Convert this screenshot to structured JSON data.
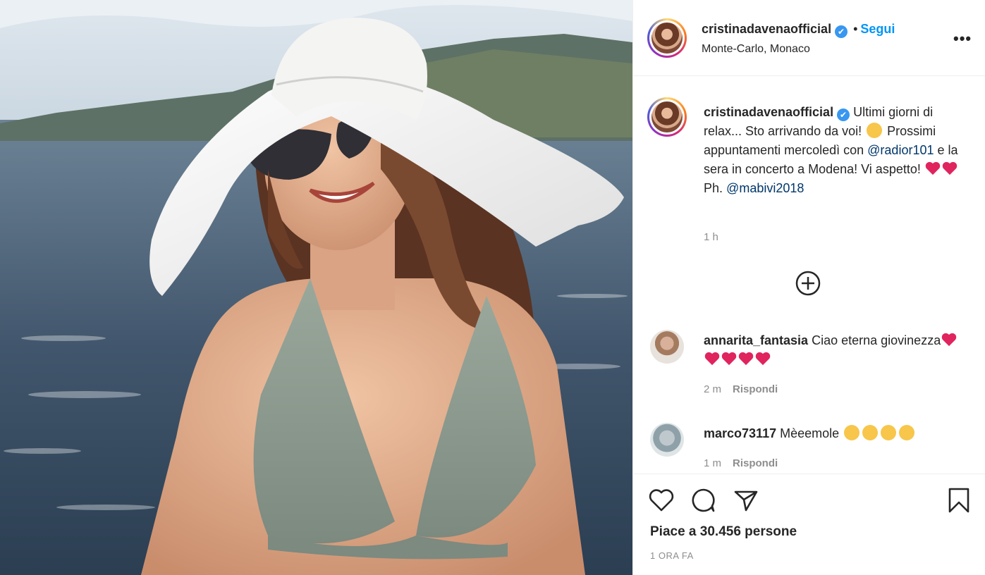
{
  "post": {
    "author": "cristinadavenaofficial",
    "verified_mark": "✔",
    "follow_separator": "•",
    "follow_label": "Segui",
    "location": "Monte-Carlo, Monaco",
    "more_label": "•••"
  },
  "caption": {
    "username": "cristinadavenaofficial",
    "text_1": "Ultimi giorni di relax... Sto arrivando da voi!",
    "text_2": "Prossimi appuntamenti mercoledì con",
    "mention_1": "@radior101",
    "text_3": "e la sera in concerto a Modena! Vi aspetto!",
    "text_4": "Ph.",
    "mention_2": "@mabivi2018",
    "time": "1 h"
  },
  "comments": [
    {
      "username": "annarita_fantasia",
      "text_1": "Ciao eterna",
      "text_2": "giovinezza",
      "time": "2 m",
      "reply": "Rispondi"
    },
    {
      "username": "marco73117",
      "text": "Mèeemole",
      "time": "1 m",
      "reply": "Rispondi"
    }
  ],
  "icons": {
    "like": "heart-outline-icon",
    "comment": "speech-bubble-icon",
    "share": "paper-plane-icon",
    "save": "bookmark-icon",
    "load_more": "plus-circle-icon",
    "options": "ellipsis-icon"
  },
  "likes_text": "Piace a 30.456 persone",
  "posted_ago": "1 ORA FA",
  "colors": {
    "link_blue": "#0095f6",
    "mention_blue": "#00376b",
    "verified_blue": "#3897f0",
    "muted_gray": "#8e8e8e",
    "text_dark": "#262626",
    "heart_red": "#e0245e"
  }
}
